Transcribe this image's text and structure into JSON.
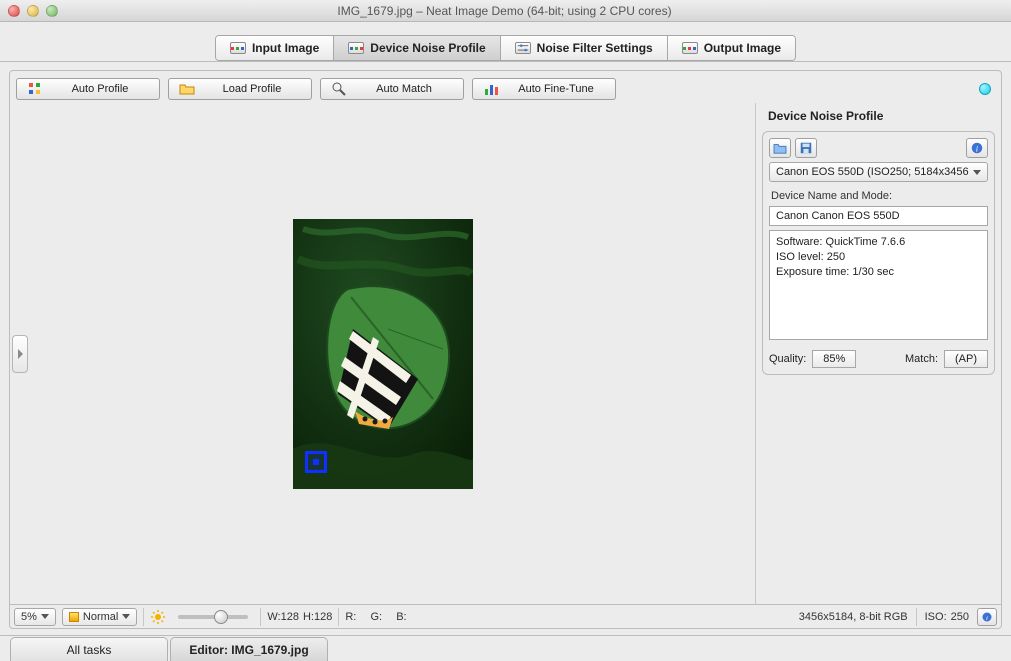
{
  "window": {
    "title": "IMG_1679.jpg – Neat Image Demo (64-bit; using 2 CPU cores)"
  },
  "main_tabs": {
    "input_image": "Input Image",
    "device_noise_profile": "Device Noise Profile",
    "noise_filter_settings": "Noise Filter Settings",
    "output_image": "Output Image",
    "active": "device_noise_profile"
  },
  "toolbar": {
    "auto_profile": "Auto Profile",
    "load_profile": "Load Profile",
    "auto_match": "Auto Match",
    "auto_fine_tune": "Auto Fine-Tune"
  },
  "right_panel": {
    "title": "Device Noise Profile",
    "profile_select": "Canon EOS 550D (ISO250; 5184x3456",
    "device_label": "Device Name and Mode:",
    "device_value": "Canon Canon EOS 550D",
    "metadata_text": "Software: QuickTime 7.6.6\nISO level: 250\nExposure time: 1/30 sec",
    "quality_label": "Quality:",
    "quality_value": "85%",
    "match_label": "Match:",
    "match_value": "(AP)"
  },
  "statusbar": {
    "zoom": "5%",
    "viewmode": "Normal",
    "selection_w_label": "W:128",
    "selection_h_label": "H:128",
    "r_label": "R:",
    "g_label": "G:",
    "b_label": "B:",
    "dimensions": "3456x5184, 8-bit RGB",
    "iso_label": "ISO:",
    "iso_value": "250"
  },
  "bottom_tabs": {
    "all_tasks": "All tasks",
    "editor": "Editor: IMG_1679.jpg"
  },
  "icons": {
    "folder": "folder-open-icon",
    "disk": "save-disk-icon",
    "info": "info-icon",
    "sun": "brightness-icon",
    "magic": "wand-icon",
    "chart": "bar-chart-icon"
  }
}
